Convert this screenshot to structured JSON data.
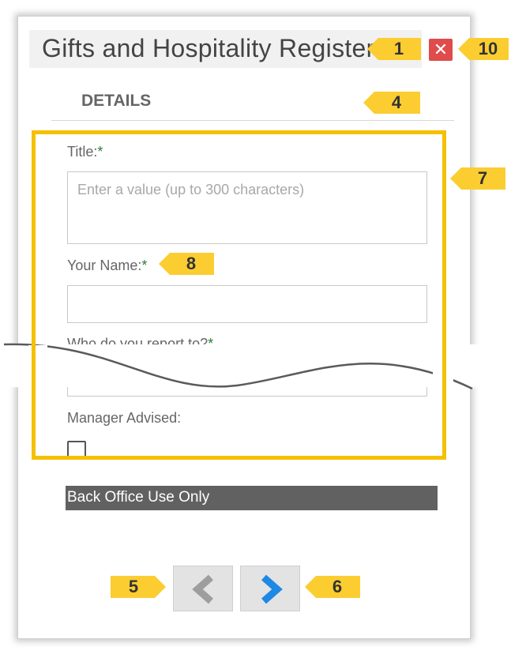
{
  "dialog": {
    "title": "Gifts and Hospitality Register",
    "close_symbol": "✕"
  },
  "tabs": [
    {
      "label": "DETAILS"
    }
  ],
  "form": {
    "title_field": {
      "label": "Title:",
      "required_mark": "*",
      "placeholder": "Enter a value (up to 300 characters)",
      "value": ""
    },
    "your_name_field": {
      "label": "Your Name:",
      "required_mark": "*",
      "value": ""
    },
    "report_to_field": {
      "label": "Who do you report to?",
      "required_mark": "*"
    },
    "manager_advised": {
      "label": "Manager Advised:",
      "checked": false
    }
  },
  "section_header": "Back Office Use Only",
  "navigation": {
    "prev_icon": "chevron-left-icon",
    "next_icon": "chevron-right-icon"
  },
  "annotations": {
    "badges": [
      {
        "number": "1"
      },
      {
        "number": "10"
      },
      {
        "number": "4"
      },
      {
        "number": "7"
      },
      {
        "number": "8"
      },
      {
        "number": "5"
      },
      {
        "number": "6"
      }
    ],
    "highlight_color": "#f5c000",
    "badge_color": "#fbcd31"
  },
  "colors": {
    "close_button": "#e04b4b",
    "prev_chevron": "#9e9e9e",
    "next_chevron": "#1e88e5",
    "section_header_bg": "#616161",
    "required_mark": "#2e7d32"
  }
}
